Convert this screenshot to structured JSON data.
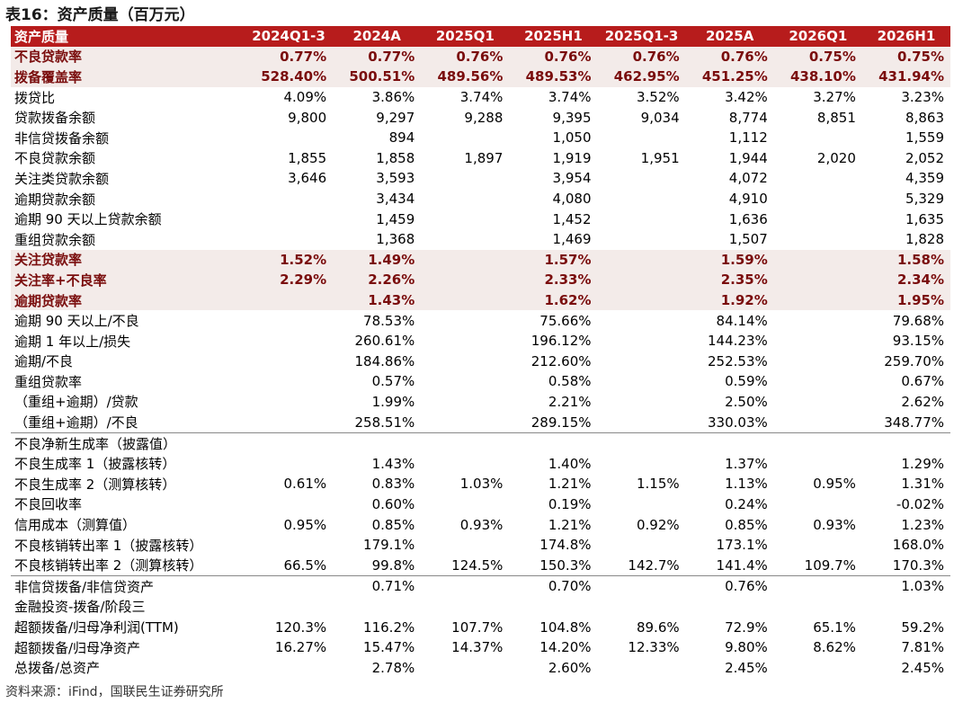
{
  "title": "表16：资产质量（百万元）",
  "source": "资料来源：iFind，国联民生证券研究所",
  "colors": {
    "header_bg": "#b71c1c",
    "highlight_bg": "#f3ebe9",
    "highlight_text": "#7a0d0d"
  },
  "table": {
    "header": [
      "资产质量",
      "2024Q1-3",
      "2024A",
      "2025Q1",
      "2025H1",
      "2025Q1-3",
      "2025A",
      "2026Q1",
      "2026H1"
    ],
    "rows": [
      {
        "label": "不良贷款率",
        "highlight": true,
        "values": [
          "0.77%",
          "0.77%",
          "0.76%",
          "0.76%",
          "0.76%",
          "0.76%",
          "0.75%",
          "0.75%"
        ]
      },
      {
        "label": "拨备覆盖率",
        "highlight": true,
        "values": [
          "528.40%",
          "500.51%",
          "489.56%",
          "489.53%",
          "462.95%",
          "451.25%",
          "438.10%",
          "431.94%"
        ]
      },
      {
        "label": "拨贷比",
        "values": [
          "4.09%",
          "3.86%",
          "3.74%",
          "3.74%",
          "3.52%",
          "3.42%",
          "3.27%",
          "3.23%"
        ]
      },
      {
        "label": "贷款拨备余额",
        "values": [
          "9,800",
          "9,297",
          "9,288",
          "9,395",
          "9,034",
          "8,774",
          "8,851",
          "8,863"
        ]
      },
      {
        "label": "非信贷拨备余额",
        "values": [
          "",
          "894",
          "",
          "1,050",
          "",
          "1,112",
          "",
          "1,559"
        ]
      },
      {
        "label": "不良贷款余额",
        "values": [
          "1,855",
          "1,858",
          "1,897",
          "1,919",
          "1,951",
          "1,944",
          "2,020",
          "2,052"
        ]
      },
      {
        "label": "关注类贷款余额",
        "values": [
          "3,646",
          "3,593",
          "",
          "3,954",
          "",
          "4,072",
          "",
          "4,359"
        ]
      },
      {
        "label": "逾期贷款余额",
        "values": [
          "",
          "3,434",
          "",
          "4,080",
          "",
          "4,910",
          "",
          "5,329"
        ]
      },
      {
        "label": "逾期 90 天以上贷款余额",
        "values": [
          "",
          "1,459",
          "",
          "1,452",
          "",
          "1,636",
          "",
          "1,635"
        ]
      },
      {
        "label": "重组贷款余额",
        "values": [
          "",
          "1,368",
          "",
          "1,469",
          "",
          "1,507",
          "",
          "1,828"
        ]
      },
      {
        "label": "关注贷款率",
        "highlight": true,
        "values": [
          "1.52%",
          "1.49%",
          "",
          "1.57%",
          "",
          "1.59%",
          "",
          "1.58%"
        ]
      },
      {
        "label": "关注率+不良率",
        "highlight": true,
        "values": [
          "2.29%",
          "2.26%",
          "",
          "2.33%",
          "",
          "2.35%",
          "",
          "2.34%"
        ]
      },
      {
        "label": "逾期贷款率",
        "highlight": true,
        "values": [
          "",
          "1.43%",
          "",
          "1.62%",
          "",
          "1.92%",
          "",
          "1.95%"
        ]
      },
      {
        "label": "逾期 90 天以上/不良",
        "values": [
          "",
          "78.53%",
          "",
          "75.66%",
          "",
          "84.14%",
          "",
          "79.68%"
        ]
      },
      {
        "label": "逾期 1 年以上/损失",
        "values": [
          "",
          "260.61%",
          "",
          "196.12%",
          "",
          "144.23%",
          "",
          "93.15%"
        ]
      },
      {
        "label": "逾期/不良",
        "values": [
          "",
          "184.86%",
          "",
          "212.60%",
          "",
          "252.53%",
          "",
          "259.70%"
        ]
      },
      {
        "label": "重组贷款率",
        "values": [
          "",
          "0.57%",
          "",
          "0.58%",
          "",
          "0.59%",
          "",
          "0.67%"
        ]
      },
      {
        "label": "（重组+逾期）/贷款",
        "values": [
          "",
          "1.99%",
          "",
          "2.21%",
          "",
          "2.50%",
          "",
          "2.62%"
        ]
      },
      {
        "label": "（重组+逾期）/不良",
        "values": [
          "",
          "258.51%",
          "",
          "289.15%",
          "",
          "330.03%",
          "",
          "348.77%"
        ]
      },
      {
        "label": "不良净新生成率（披露值）",
        "separator": true,
        "values": [
          "",
          "",
          "",
          "",
          "",
          "",
          "",
          ""
        ]
      },
      {
        "label": "不良生成率 1（披露核转）",
        "values": [
          "",
          "1.43%",
          "",
          "1.40%",
          "",
          "1.37%",
          "",
          "1.29%"
        ]
      },
      {
        "label": "不良生成率 2（测算核转）",
        "values": [
          "0.61%",
          "0.83%",
          "1.03%",
          "1.21%",
          "1.15%",
          "1.13%",
          "0.95%",
          "1.31%"
        ]
      },
      {
        "label": "不良回收率",
        "values": [
          "",
          "0.60%",
          "",
          "0.19%",
          "",
          "0.24%",
          "",
          "-0.02%"
        ]
      },
      {
        "label": "信用成本（测算值）",
        "values": [
          "0.95%",
          "0.85%",
          "0.93%",
          "1.21%",
          "0.92%",
          "0.85%",
          "0.93%",
          "1.23%"
        ]
      },
      {
        "label": "不良核销转出率 1（披露核转）",
        "values": [
          "",
          "179.1%",
          "",
          "174.8%",
          "",
          "173.1%",
          "",
          "168.0%"
        ]
      },
      {
        "label": "不良核销转出率 2（测算核转）",
        "values": [
          "66.5%",
          "99.8%",
          "124.5%",
          "150.3%",
          "142.7%",
          "141.4%",
          "109.7%",
          "170.3%"
        ]
      },
      {
        "label": "非信贷拨备/非信贷资产",
        "separator": true,
        "values": [
          "",
          "0.71%",
          "",
          "0.70%",
          "",
          "0.76%",
          "",
          "1.03%"
        ]
      },
      {
        "label": "金融投资-拨备/阶段三",
        "values": [
          "",
          "",
          "",
          "",
          "",
          "",
          "",
          ""
        ]
      },
      {
        "label": "超额拨备/归母净利润(TTM)",
        "values": [
          "120.3%",
          "116.2%",
          "107.7%",
          "104.8%",
          "89.6%",
          "72.9%",
          "65.1%",
          "59.2%"
        ]
      },
      {
        "label": "超额拨备/归母净资产",
        "values": [
          "16.27%",
          "15.47%",
          "14.37%",
          "14.20%",
          "12.33%",
          "9.80%",
          "8.62%",
          "7.81%"
        ]
      },
      {
        "label": "总拨备/总资产",
        "values": [
          "",
          "2.78%",
          "",
          "2.60%",
          "",
          "2.45%",
          "",
          "2.45%"
        ]
      }
    ]
  }
}
